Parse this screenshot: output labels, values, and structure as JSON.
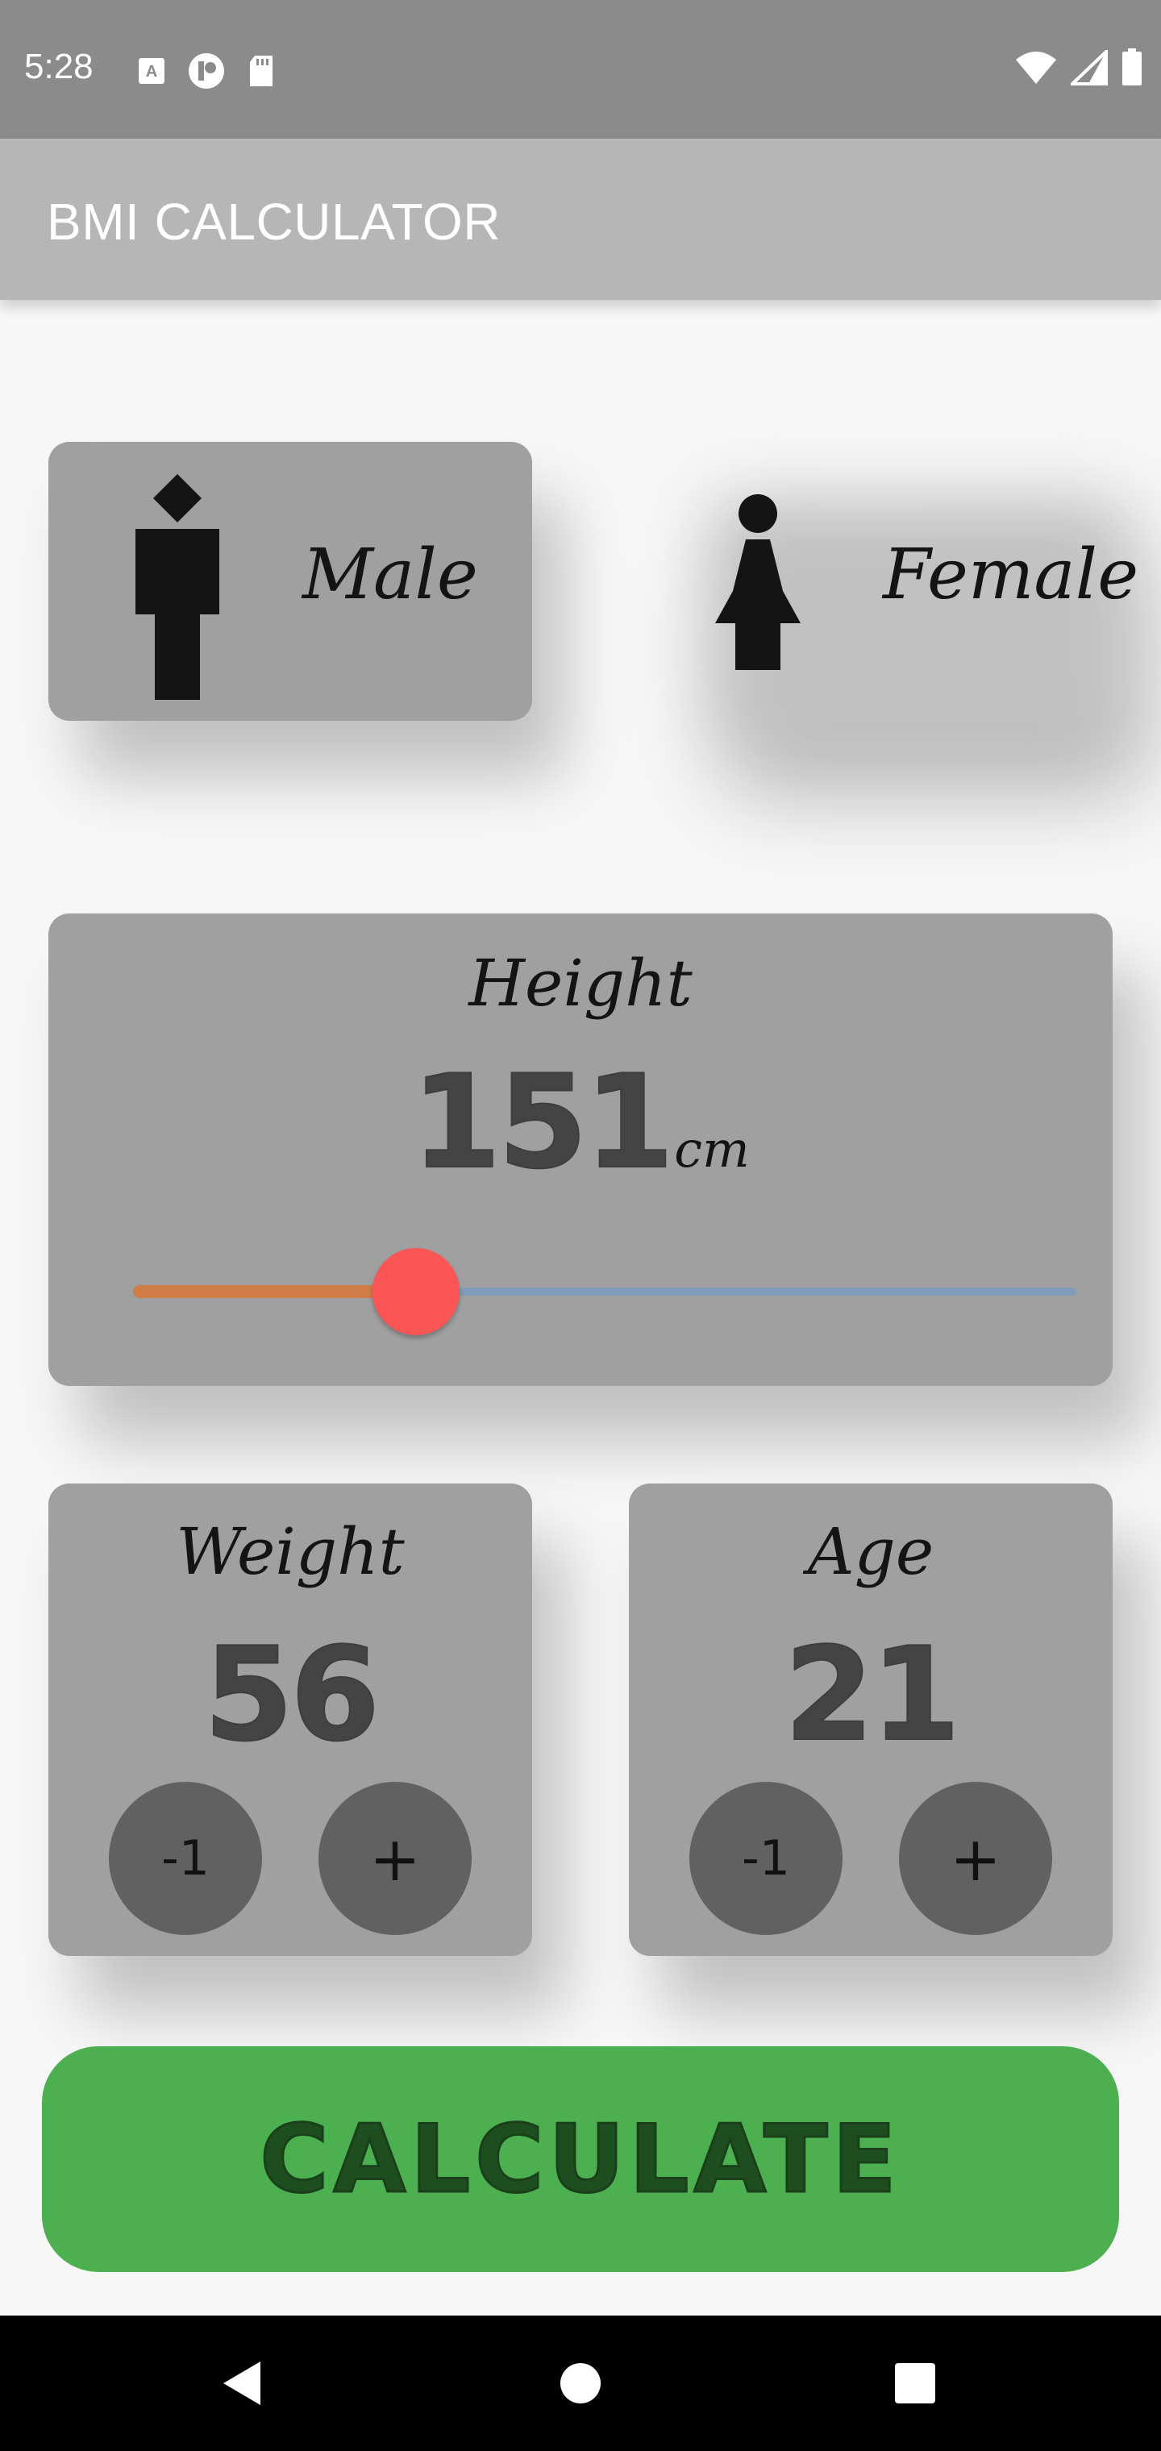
{
  "status_bar": {
    "time": "5:28",
    "left_icons": [
      "text-a-icon",
      "app-circle-icon",
      "sd-card-icon"
    ],
    "right_icons": [
      "wifi-icon",
      "signal-icon",
      "battery-icon"
    ]
  },
  "app_bar": {
    "title": "BMI CALCULATOR"
  },
  "gender": {
    "male_label": "Male",
    "female_label": "Female",
    "selected": "Male"
  },
  "height": {
    "label": "Height",
    "value": "151",
    "unit": "cm",
    "slider_fraction": 0.3
  },
  "weight": {
    "label": "Weight",
    "value": "56",
    "minus_label": "-1",
    "plus_label": "+"
  },
  "age": {
    "label": "Age",
    "value": "21",
    "minus_label": "-1",
    "plus_label": "+"
  },
  "calculate": {
    "label": "CALCULATE"
  },
  "colors": {
    "card": "#a0a0a0",
    "accent_button": "#4caf50",
    "slider_active": "#d07c47",
    "slider_inactive": "#7f9db8",
    "slider_thumb": "#fb5556"
  },
  "nav_bar": {
    "icons": [
      "back-icon",
      "home-icon",
      "recents-icon"
    ]
  }
}
